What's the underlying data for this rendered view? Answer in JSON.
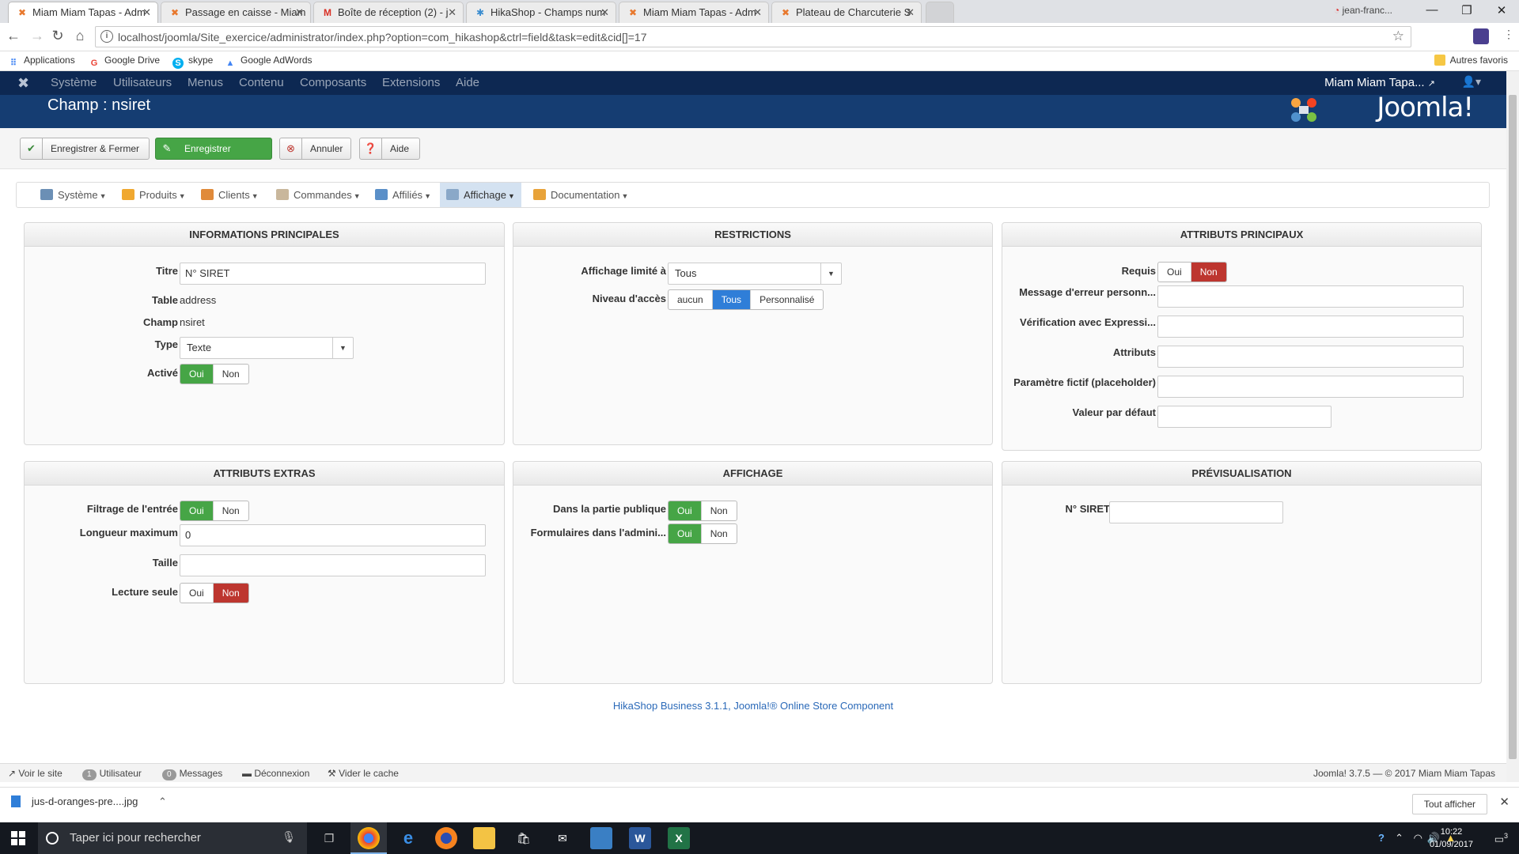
{
  "browser": {
    "tabs": [
      {
        "title": "Miam Miam Tapas - Adm",
        "active": true
      },
      {
        "title": "Passage en caisse - Miam",
        "active": false
      },
      {
        "title": "Boîte de réception (2) - j",
        "active": false
      },
      {
        "title": "HikaShop - Champs num",
        "active": false
      },
      {
        "title": "Miam Miam Tapas - Adm",
        "active": false
      },
      {
        "title": "Plateau de Charcuterie S",
        "active": false
      }
    ],
    "user": "jean-franc...",
    "url": "localhost/joomla/Site_exercice/administrator/index.php?option=com_hikashop&ctrl=field&task=edit&cid[]=17",
    "bookmarks": [
      "Applications",
      "Google Drive",
      "skype",
      "Google AdWords"
    ],
    "other_bookmarks": "Autres favoris"
  },
  "joomla": {
    "menu": [
      "Système",
      "Utilisateurs",
      "Menus",
      "Contenu",
      "Composants",
      "Extensions",
      "Aide"
    ],
    "site_name": "Miam Miam Tapa...",
    "page_title": "Champ : nsiret",
    "brand": "Joomla!"
  },
  "toolbar": {
    "save_close": "Enregistrer & Fermer",
    "save": "Enregistrer",
    "cancel": "Annuler",
    "help": "Aide"
  },
  "submenu": [
    "Système",
    "Produits",
    "Clients",
    "Commandes",
    "Affiliés",
    "Affichage",
    "Documentation"
  ],
  "main_info": {
    "heading": "INFORMATIONS PRINCIPALES",
    "title_label": "Titre",
    "title_value": "N° SIRET",
    "table_label": "Table",
    "table_value": "address",
    "field_label": "Champ",
    "field_value": "nsiret",
    "type_label": "Type",
    "type_value": "Texte",
    "active_label": "Activé",
    "yes": "Oui",
    "no": "Non"
  },
  "restrictions": {
    "heading": "RESTRICTIONS",
    "display_label": "Affichage limité à",
    "display_value": "Tous",
    "access_label": "Niveau d'accès",
    "access_options": [
      "aucun",
      "Tous",
      "Personnalisé"
    ]
  },
  "main_attrs": {
    "heading": "ATTRIBUTS PRINCIPAUX",
    "required_label": "Requis",
    "error_label": "Message d'erreur personn...",
    "regex_label": "Vérification avec Expressi...",
    "attributes_label": "Attributs",
    "placeholder_label": "Paramètre fictif (placeholder)",
    "default_label": "Valeur par défaut"
  },
  "extra_attrs": {
    "heading": "ATTRIBUTS EXTRAS",
    "filter_label": "Filtrage de l'entrée",
    "maxlen_label": "Longueur maximum",
    "maxlen_value": "0",
    "size_label": "Taille",
    "readonly_label": "Lecture seule"
  },
  "display": {
    "heading": "AFFICHAGE",
    "public_label": "Dans la partie publique",
    "admin_label": "Formulaires dans l'admini..."
  },
  "preview": {
    "heading": "PRÉVISUALISATION",
    "field_label": "N° SIRET"
  },
  "footer_link": "HikaShop Business 3.1.1, Joomla!® Online Store Component",
  "statusbar": {
    "view_site": "Voir le site",
    "user_count": "1",
    "user_label": "Utilisateur",
    "msg_count": "0",
    "msg_label": "Messages",
    "logout": "Déconnexion",
    "clear_cache": "Vider le cache",
    "version": "Joomla! 3.7.5 — © 2017 Miam Miam Tapas"
  },
  "downloads": {
    "file": "jus-d-oranges-pre....jpg",
    "show_all": "Tout afficher"
  },
  "taskbar": {
    "search_placeholder": "Taper ici pour rechercher",
    "time": "10:22",
    "date": "01/09/2017",
    "notif_count": "3"
  },
  "colors": {
    "joomla_nav": "#0d2852",
    "joomla_header": "#153d72",
    "toggle_yes": "#46a546",
    "toggle_no": "#bd362f",
    "toggle_selected": "#2f7ed8",
    "link": "#2a69b8"
  }
}
